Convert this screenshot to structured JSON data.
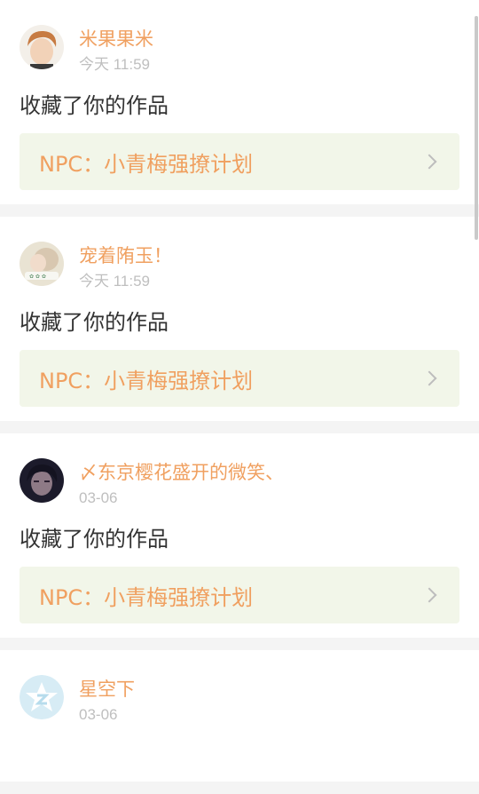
{
  "notifications": [
    {
      "user": "米果果米",
      "time": "今天 11:59",
      "action": "收藏了你的作品",
      "work": "NPC：小青梅强撩计划",
      "avatar_icon": "user-avatar-photo",
      "avatar_colors": [
        "#c77b42",
        "#f2d2b8"
      ]
    },
    {
      "user": "宠着陏玉！",
      "time": "今天 11:59",
      "action": "收藏了你的作品",
      "work": "NPC：小青梅强撩计划",
      "avatar_icon": "user-avatar-photo",
      "avatar_colors": [
        "#e9e3d3",
        "#6f9b79"
      ]
    },
    {
      "user": "〆东京樱花盛开的微笑、",
      "time": "03-06",
      "action": "收藏了你的作品",
      "work": "NPC：小青梅强撩计划",
      "avatar_icon": "user-avatar-photo",
      "avatar_colors": [
        "#1c1b2b",
        "#8e7a86"
      ]
    },
    {
      "user": "星空下",
      "time": "03-06",
      "action": "",
      "work": "",
      "avatar_icon": "default-avatar-icon",
      "avatar_colors": [
        "#d7ecf5",
        "#ffffff"
      ]
    }
  ],
  "colors": {
    "username": "#f0a060",
    "time": "#bfbfbf",
    "work_bg": "#f2f6e9",
    "page_bg": "#f4f4f4"
  }
}
